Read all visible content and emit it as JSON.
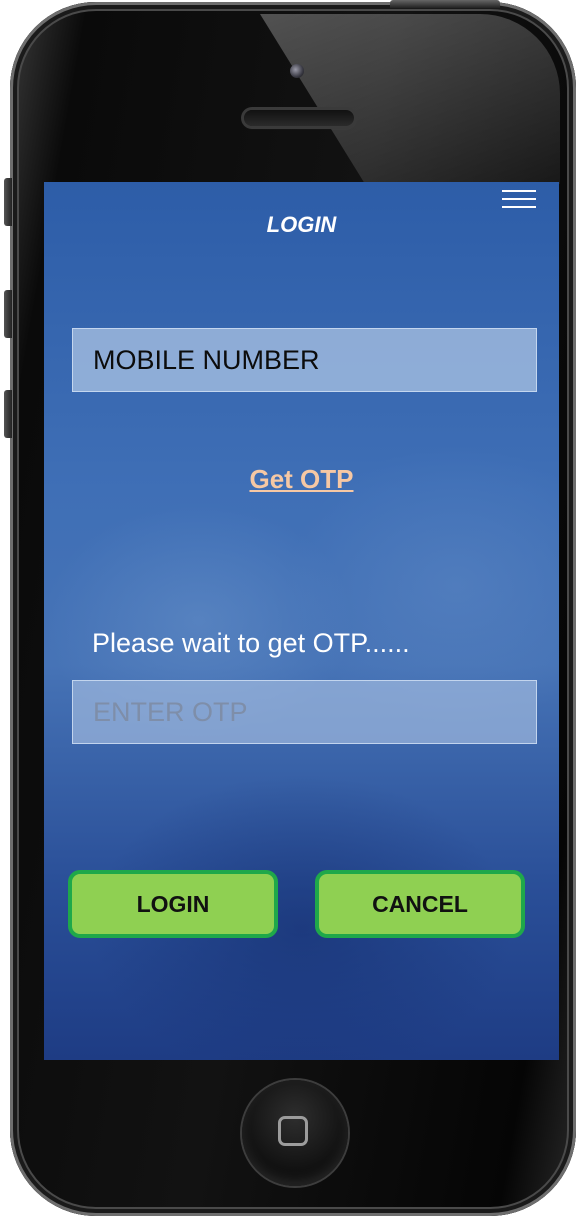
{
  "screen": {
    "title": "LOGIN",
    "mobile_field": {
      "placeholder": "MOBILE NUMBER"
    },
    "get_otp_link": "Get OTP",
    "wait_message": "Please wait to get OTP......",
    "otp_field": {
      "placeholder": "ENTER OTP"
    },
    "buttons": {
      "login": "LOGIN",
      "cancel": "CANCEL"
    }
  },
  "icons": {
    "menu": "hamburger-menu-icon",
    "home": "home-button-icon"
  },
  "colors": {
    "screen_background": "#3f6fb6",
    "button_fill": "#8fd052",
    "button_border": "#1fa84a",
    "link": "#f6c8a4"
  }
}
